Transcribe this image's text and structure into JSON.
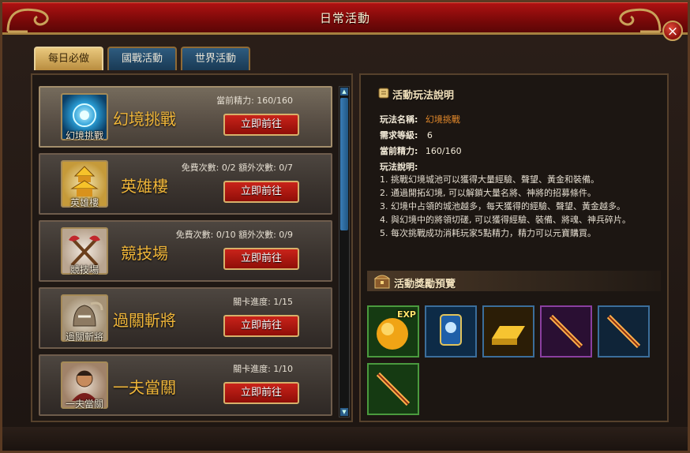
{
  "window": {
    "title": "日常活動",
    "close_label": "×"
  },
  "tabs": [
    {
      "label": "每日必做",
      "active": true
    },
    {
      "label": "國戰活動",
      "active": false
    },
    {
      "label": "世界活動",
      "active": false
    }
  ],
  "activities": [
    {
      "name": "幻境挑戰",
      "icon_label": "幻境挑戰",
      "icon": "portal-icon",
      "info1": "當前精力: 160/160",
      "info2": "",
      "button": "立即前往",
      "selected": true
    },
    {
      "name": "英雄樓",
      "icon_label": "英雄樓",
      "icon": "pagoda-icon",
      "info1": "免費次數: 0/2  額外次數: 0/7",
      "info2": "",
      "button": "立即前往",
      "selected": false
    },
    {
      "name": "競技場",
      "icon_label": "競技場",
      "icon": "crossed-axes-icon",
      "info1": "免費次數: 0/10  額外次數: 0/9",
      "info2": "",
      "button": "立即前往",
      "selected": false
    },
    {
      "name": "過關斬將",
      "icon_label": "過關斬將",
      "icon": "helmet-icon",
      "info1": "關卡進度: 1/15",
      "info2": "",
      "button": "立即前往",
      "selected": false
    },
    {
      "name": "一夫當關",
      "icon_label": "一夫當關",
      "icon": "warrior-icon",
      "info1": "關卡進度: 1/10",
      "info2": "",
      "button": "立即前往",
      "selected": false
    }
  ],
  "detail": {
    "title": "活動玩法說明",
    "name_label": "玩法名稱:",
    "name_value": "幻境挑戰",
    "level_label": "需求等級:",
    "level_value": "6",
    "energy_label": "當前精力:",
    "energy_value": "160/160",
    "desc_label": "玩法說明:",
    "desc_lines": [
      "1. 挑戰幻境城池可以獲得大量經驗、聲望、黃金和裝備。",
      "2. 通過開拓幻境, 可以解鎖大量名將、神將的招募條件。",
      "3. 幻境中占領的城池越多，每天獲得的經驗、聲望、黃金越多。",
      "4. 與幻境中的將領切磋, 可以獲得經驗、裝備、將魂、神兵碎片。",
      "5. 每次挑戰成功消耗玩家5點精力，精力可以元寶購買。"
    ],
    "rewards_title": "活動獎勵預覽",
    "rewards": [
      {
        "icon": "exp-orb-icon",
        "tag": "EXP"
      },
      {
        "icon": "banner-icon",
        "tag": ""
      },
      {
        "icon": "gold-bar-icon",
        "tag": ""
      },
      {
        "icon": "purple-sword-icon",
        "tag": ""
      },
      {
        "icon": "blue-sword-icon",
        "tag": ""
      },
      {
        "icon": "green-sword-icon",
        "tag": ""
      }
    ]
  },
  "colors": {
    "accent_red": "#b01212",
    "gold": "#f0b63a",
    "orange_value": "#e58a2b",
    "tab_blue": "#2e5b7e"
  }
}
